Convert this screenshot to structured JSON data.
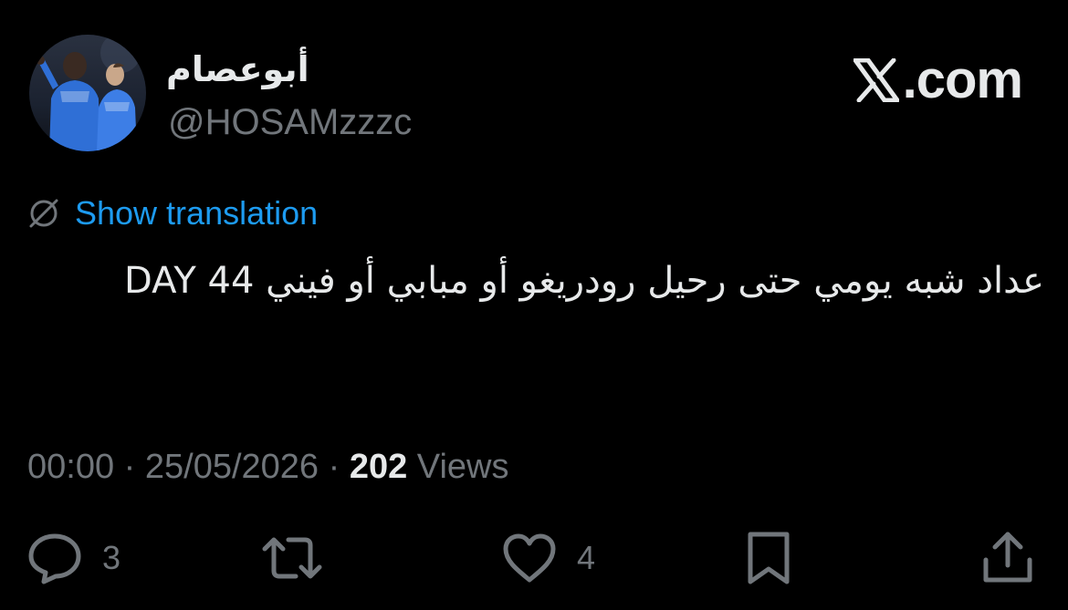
{
  "author": {
    "display_name": "أبوعصام",
    "handle": "@HOSAMzzzc",
    "avatar": "profile-photo"
  },
  "brand": {
    "text": ".com",
    "icon": "x-logo-icon"
  },
  "translation": {
    "label": "Show translation",
    "icon": "translate-globe-icon",
    "color": "#1d9bf0"
  },
  "tweet": {
    "text": "عداد شبه يومي حتى رحيل رودريغو أو مبابي أو فيني  DAY 44"
  },
  "meta": {
    "time": "00:00",
    "separator_1": " · ",
    "date": "25/05/2026",
    "separator_2": " · ",
    "views_count": "202",
    "views_label": " Views"
  },
  "actions": {
    "replies": {
      "icon": "reply-icon",
      "count": "3"
    },
    "reposts": {
      "icon": "repost-icon",
      "count": ""
    },
    "likes": {
      "icon": "heart-icon",
      "count": "4"
    },
    "bookmark": {
      "icon": "bookmark-icon"
    },
    "share": {
      "icon": "share-icon"
    }
  },
  "colors": {
    "background": "#000000",
    "text_primary": "#e7e9ea",
    "text_secondary": "#71767b",
    "accent": "#1d9bf0"
  }
}
